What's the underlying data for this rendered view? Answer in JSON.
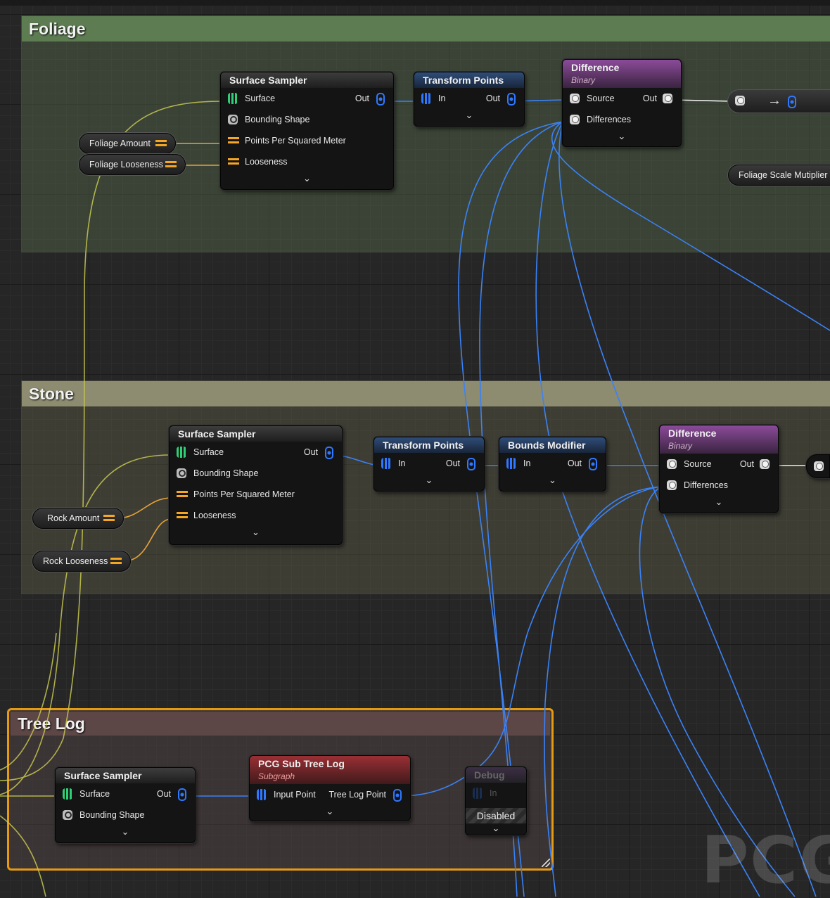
{
  "comments": {
    "foliage": "Foliage",
    "stone": "Stone",
    "treelog": "Tree Log"
  },
  "variables": {
    "foliage_amount": "Foliage Amount",
    "foliage_looseness": "Foliage Looseness",
    "foliage_scale": "Foliage Scale Mutiplier",
    "rock_amount": "Rock Amount",
    "rock_looseness": "Rock Looseness"
  },
  "nodes": {
    "surface_sampler": {
      "title": "Surface Sampler",
      "surface": "Surface",
      "out": "Out",
      "bounding_shape": "Bounding Shape",
      "points_per_sqm": "Points Per Squared Meter",
      "looseness": "Looseness"
    },
    "transform_points": {
      "title": "Transform Points",
      "in": "In",
      "out": "Out"
    },
    "bounds_modifier": {
      "title": "Bounds Modifier",
      "in": "In",
      "out": "Out"
    },
    "difference": {
      "title": "Difference",
      "subtitle": "Binary",
      "source": "Source",
      "differences": "Differences",
      "out": "Out"
    },
    "pcg_sub_tree_log": {
      "title": "PCG Sub Tree Log",
      "subtitle": "Subgraph",
      "input_point": "Input Point",
      "tree_log_point": "Tree Log Point"
    },
    "debug": {
      "title": "Debug",
      "in": "In",
      "state": "Disabled"
    }
  },
  "expand_glyph": "⌄",
  "reroute_arrow": "→",
  "watermark": "PCG",
  "colors": {
    "exec_wire": "#3b82f6",
    "float_wire": "#e8a33a",
    "surface_wire": "#c8c850",
    "comment_foliage": "#5d7c52",
    "comment_stone": "#8d8b70",
    "comment_treelog_border": "#e59a14",
    "difference_header": "#8b4b9a",
    "subgraph_header": "#9a2f34",
    "transform_header": "#2f4d78"
  },
  "icons": [
    "surface-pin-icon",
    "points-pin-icon",
    "float-pin-icon",
    "shape-pin-icon",
    "spatial-pin-icon",
    "expand-chevron-icon",
    "arrow-right-icon",
    "resize-grip-icon"
  ]
}
